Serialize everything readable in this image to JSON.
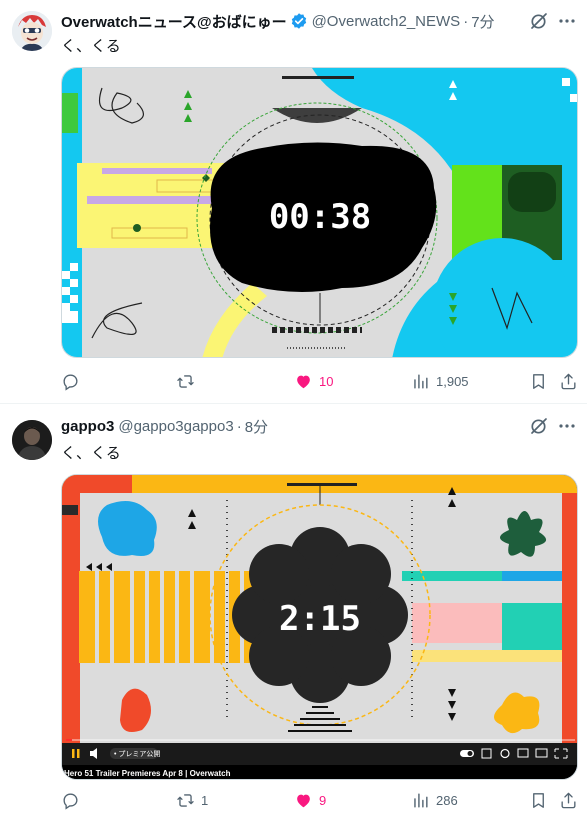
{
  "posts": [
    {
      "display_name": "Overwatchニュース@おばにゅー",
      "handle": "@Overwatch2_NEWS",
      "separator": "·",
      "time": "7分",
      "text": "く、くる",
      "media": {
        "timer": "00:38"
      },
      "actions": {
        "reply": "",
        "retweet": "",
        "like": "10",
        "views": "1,905"
      }
    },
    {
      "display_name": "gappo3",
      "handle": "@gappo3gappo3",
      "separator": "·",
      "time": "8分",
      "text": "く、くる",
      "media": {
        "timer": "2:15",
        "premiere_label": "• プレミア公開",
        "video_title": "Hero 51 Trailer Premieres Apr 8 | Overwatch"
      },
      "actions": {
        "reply": "",
        "retweet": "1",
        "like": "9",
        "views": "286"
      }
    }
  ],
  "colors": {
    "like": "#f91880",
    "secondary_text": "#536471",
    "verified": "#1d9bf0",
    "divider": "#eff3f4"
  },
  "icons": [
    "verified-badge-icon",
    "grok-icon",
    "more-icon",
    "reply-icon",
    "retweet-icon",
    "heart-icon",
    "views-icon",
    "bookmark-icon",
    "share-icon",
    "play-pause-icon",
    "volume-icon",
    "settings-icon",
    "fullscreen-icon"
  ]
}
